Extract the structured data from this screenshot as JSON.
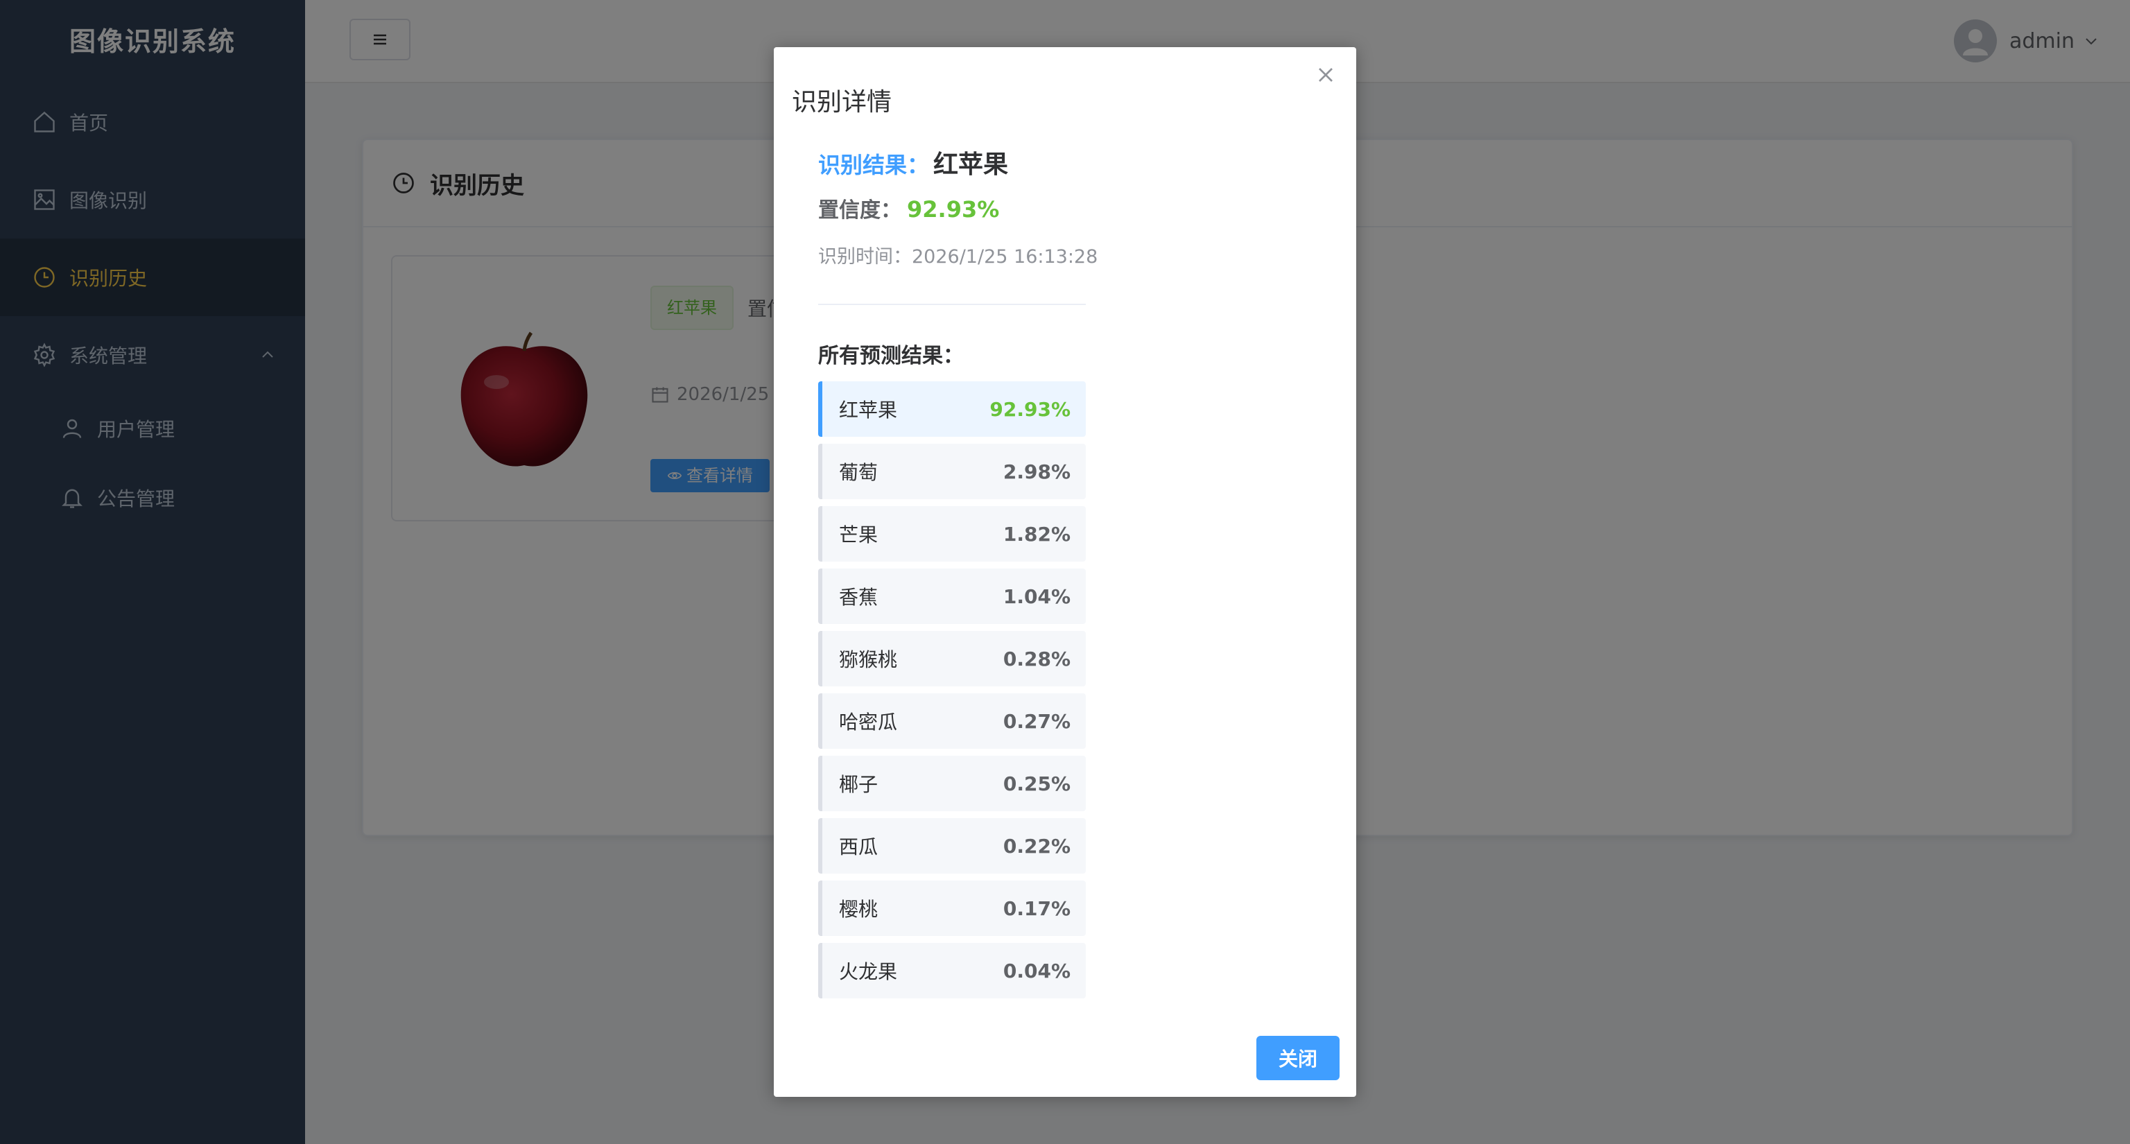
{
  "app": {
    "title": "图像识别系统"
  },
  "sidebar": {
    "items": [
      {
        "label": "首页",
        "icon": "home-icon"
      },
      {
        "label": "图像识别",
        "icon": "image-icon"
      },
      {
        "label": "识别历史",
        "icon": "clock-icon",
        "active": true
      },
      {
        "label": "系统管理",
        "icon": "gear-icon",
        "expanded": true
      },
      {
        "label": "用户管理",
        "icon": "user-icon"
      },
      {
        "label": "公告管理",
        "icon": "bell-icon"
      }
    ]
  },
  "header": {
    "username": "admin"
  },
  "card": {
    "title": "识别历史",
    "history": {
      "tag": "红苹果",
      "confidence_label": "置信",
      "date": "2026/1/25 1",
      "detail_button": "查看详情"
    }
  },
  "modal": {
    "title": "识别详情",
    "result_label": "识别结果：",
    "result_value": "红苹果",
    "confidence_label": "置信度：",
    "confidence_value": "92.93%",
    "time_label": "识别时间：",
    "time_value": "2026/1/25 16:13:28",
    "all_predictions_title": "所有预测结果：",
    "predictions": [
      {
        "name": "红苹果",
        "pct": "92.93%"
      },
      {
        "name": "葡萄",
        "pct": "2.98%"
      },
      {
        "name": "芒果",
        "pct": "1.82%"
      },
      {
        "name": "香蕉",
        "pct": "1.04%"
      },
      {
        "name": "猕猴桃",
        "pct": "0.28%"
      },
      {
        "name": "哈密瓜",
        "pct": "0.27%"
      },
      {
        "name": "椰子",
        "pct": "0.25%"
      },
      {
        "name": "西瓜",
        "pct": "0.22%"
      },
      {
        "name": "樱桃",
        "pct": "0.17%"
      },
      {
        "name": "火龙果",
        "pct": "0.04%"
      }
    ],
    "close_button": "关闭"
  },
  "colors": {
    "sidebar_bg": "#304156",
    "active_text": "#ffd04b",
    "primary": "#409eff",
    "success": "#67c23a"
  }
}
